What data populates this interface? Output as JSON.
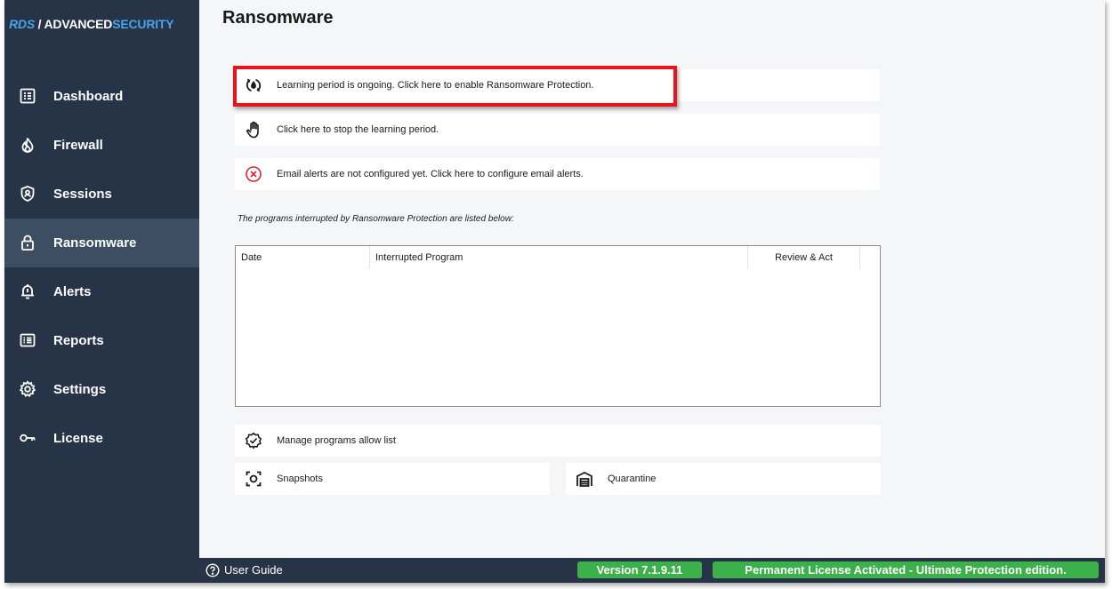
{
  "brand": {
    "part1": "RDS",
    "part2": " / ADVANCED",
    "part3": "SECURITY"
  },
  "sidebar": {
    "items": [
      {
        "label": "Dashboard",
        "icon": "dashboard-icon"
      },
      {
        "label": "Firewall",
        "icon": "flame-icon"
      },
      {
        "label": "Sessions",
        "icon": "shield-user-icon"
      },
      {
        "label": "Ransomware",
        "icon": "lock-icon",
        "active": true
      },
      {
        "label": "Alerts",
        "icon": "bell-icon"
      },
      {
        "label": "Reports",
        "icon": "report-list-icon"
      },
      {
        "label": "Settings",
        "icon": "gear-icon"
      },
      {
        "label": "License",
        "icon": "key-icon"
      }
    ]
  },
  "main": {
    "title": "Ransomware",
    "learning_text": "Learning period is ongoing. Click here to enable Ransomware Protection.",
    "stop_text": "Click here to stop the learning period.",
    "email_text": "Email alerts are not configured yet. Click here to configure email alerts.",
    "list_caption": "The programs interrupted by Ransomware Protection are listed below:",
    "table": {
      "columns": [
        "Date",
        "Interrupted Program",
        "Review & Act"
      ],
      "rows": []
    },
    "allow_list_text": "Manage programs allow list",
    "snapshots_text": "Snapshots",
    "quarantine_text": "Quarantine"
  },
  "footer": {
    "user_guide": "User Guide",
    "version": "Version 7.1.9.11",
    "license": "Permanent License Activated - Ultimate Protection edition."
  },
  "colors": {
    "sidebar_bg": "#273447",
    "sidebar_active": "#3d4e63",
    "brand_accent": "#4aa3e8",
    "highlight_red": "#e8141b",
    "status_green": "#3cb04a",
    "error_red": "#d9232e"
  }
}
